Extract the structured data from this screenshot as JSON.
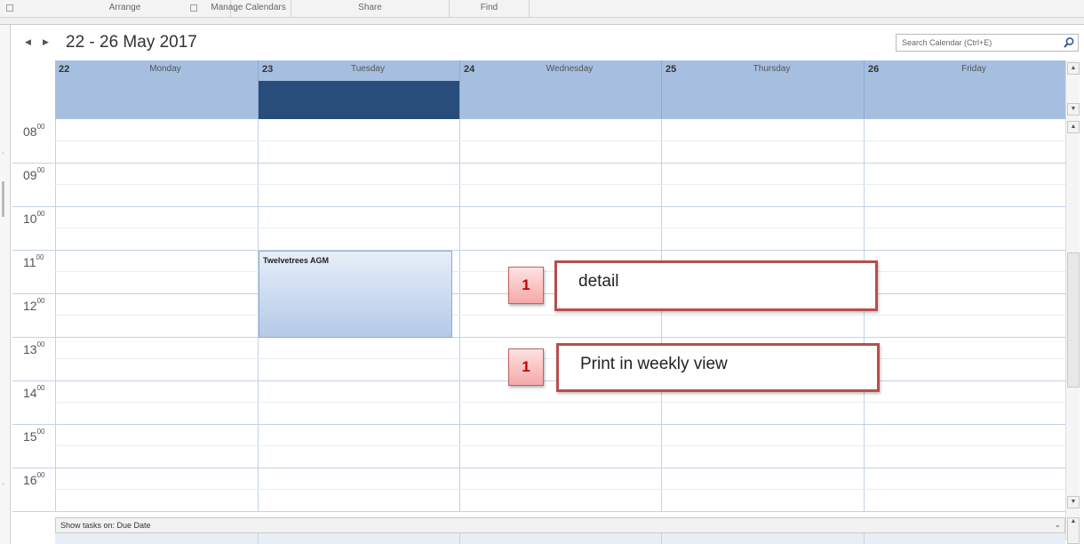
{
  "ribbon": {
    "groups": [
      "Arrange",
      "Manage Calendars",
      "Share",
      "Find"
    ]
  },
  "calendar": {
    "date_range": "22 - 26 May 2017",
    "search_placeholder": "Search Calendar (Ctrl+E)",
    "days": [
      {
        "num": "22",
        "name": "Monday"
      },
      {
        "num": "23",
        "name": "Tuesday"
      },
      {
        "num": "24",
        "name": "Wednesday"
      },
      {
        "num": "25",
        "name": "Thursday"
      },
      {
        "num": "26",
        "name": "Friday"
      }
    ],
    "selected_day": "23",
    "hours": [
      {
        "h": "08",
        "m": "00"
      },
      {
        "h": "09",
        "m": "00"
      },
      {
        "h": "10",
        "m": "00"
      },
      {
        "h": "11",
        "m": "00"
      },
      {
        "h": "12",
        "m": "00"
      },
      {
        "h": "13",
        "m": "00"
      },
      {
        "h": "14",
        "m": "00"
      },
      {
        "h": "15",
        "m": "00"
      },
      {
        "h": "16",
        "m": "00"
      }
    ],
    "appointment": {
      "title": "Twelvetrees AGM",
      "day": "Tuesday",
      "start": "11 00",
      "end": "13 00"
    },
    "tasks_label": "Show tasks on: Due Date"
  },
  "callouts": [
    {
      "badge": "1",
      "text": "detail"
    },
    {
      "badge": "1",
      "text": "Print in weekly view"
    }
  ],
  "colors": {
    "header_band": "#a6bfe0",
    "selected_day": "#284d7b",
    "callout_border": "#b84e4c",
    "badge_text": "#cc0000"
  },
  "icons": [
    "prev-arrow-icon",
    "next-arrow-icon",
    "search-icon",
    "scroll-up-icon",
    "scroll-down-icon",
    "chevron-down-icon"
  ]
}
